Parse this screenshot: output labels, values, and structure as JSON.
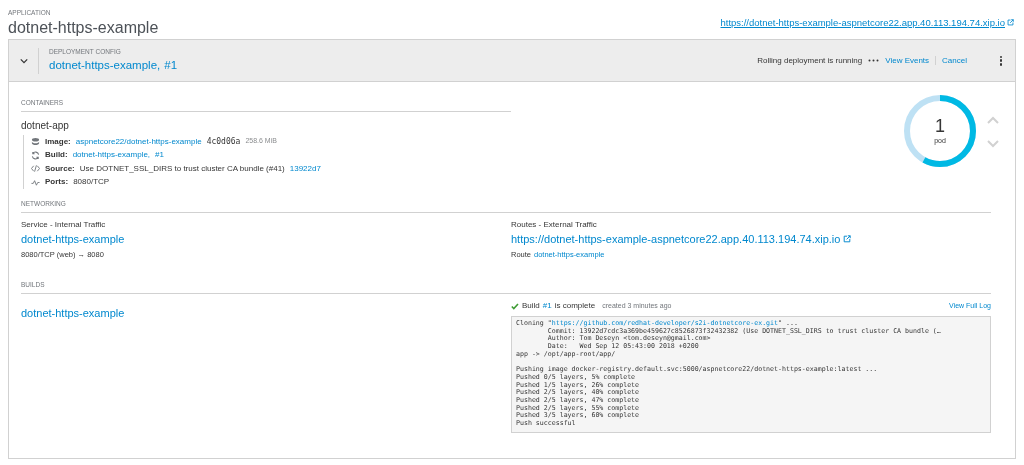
{
  "application": {
    "label": "APPLICATION",
    "name": "dotnet-https-example",
    "url": "https://dotnet-https-example-aspnetcore22.app.40.113.194.74.xip.io"
  },
  "deployment": {
    "label": "DEPLOYMENT CONFIG",
    "name": "dotnet-https-example",
    "revision": "#1",
    "separator": ",",
    "expanded": true,
    "status": "Rolling deployment is running",
    "view_events": "View Events",
    "cancel": "Cancel"
  },
  "containers": {
    "label": "CONTAINERS",
    "name": "dotnet-app",
    "details": [
      {
        "kind": "image",
        "label": "Image:",
        "link": "aspnetcore22/dotnet-https-example",
        "mono": "4c0d06a",
        "extra": "258.6 MiB"
      },
      {
        "kind": "build",
        "label": "Build:",
        "link": "dotnet-https-example",
        "sep": ",",
        "link2": "#1"
      },
      {
        "kind": "source",
        "label": "Source:",
        "text": "Use DOTNET_SSL_DIRS to trust cluster CA bundle (#41)",
        "link": "13922d7"
      },
      {
        "kind": "ports",
        "label": "Ports:",
        "text": "8080/TCP"
      }
    ]
  },
  "pods": {
    "count": "1",
    "unit": "pod",
    "level": 0.58
  },
  "networking": {
    "label": "NETWORKING",
    "service_label": "Service - Internal Traffic",
    "service": "dotnet-https-example",
    "service_ports": "8080/TCP (web) → 8080",
    "routes_label": "Routes - External Traffic",
    "route_url": "https://dotnet-https-example-aspnetcore22.app.40.113.194.74.xip.io",
    "route_prefix": "Route",
    "route_name": "dotnet-https-example"
  },
  "builds": {
    "label": "BUILDS",
    "name": "dotnet-https-example",
    "status_prefix": "Build",
    "build": "#1",
    "status_suffix": "is complete",
    "created": "created 3 minutes ago",
    "view_log": "View Full Log",
    "log_first": {
      "prefix": "Cloning \"",
      "url": "https://github.com/redhat-developer/s2i-dotnetcore-ex.git",
      "suffix": "\" ..."
    },
    "log": [
      [
        "        Commit: 13922d7cdc3a369be459627c8526873f32432382 (Use DOTNET_SSL_DIRS to trust cluster CA bundle (…",
        "        Author: Tom Deseyn <tom.deseyn@gmail.com>",
        "        Date:   Wed Sep 12 05:43:00 2018 +0200",
        "app -> /opt/app-root/app/"
      ],
      [
        "Pushing image docker-registry.default.svc:5000/aspnetcore22/dotnet-https-example:latest ...",
        "Pushed 0/5 layers, 5% complete",
        "Pushed 1/5 layers, 26% complete",
        "Pushed 2/5 layers, 40% complete",
        "Pushed 2/5 layers, 47% complete",
        "Pushed 2/5 layers, 55% complete",
        "Pushed 3/5 layers, 60% complete",
        "Push successful"
      ]
    ]
  }
}
